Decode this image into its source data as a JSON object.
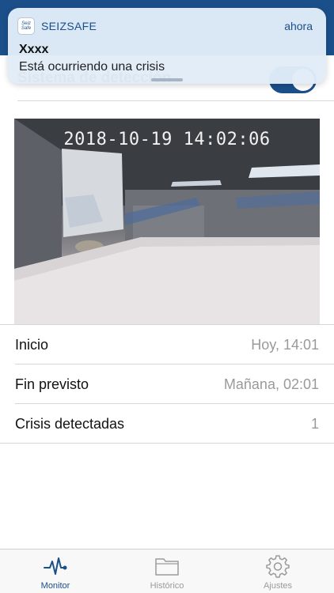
{
  "notification": {
    "app_icon_text": "Seiz Safe",
    "app_name": "SEIZSAFE",
    "time": "ahora",
    "title": "Xxxx",
    "body": "Está ocurriendo una crisis"
  },
  "detection": {
    "label": "Sistema de detección",
    "enabled": true
  },
  "camera": {
    "timestamp": "2018-10-19  14:02:06"
  },
  "info": {
    "rows": [
      {
        "label": "Inicio",
        "value": "Hoy, 14:01"
      },
      {
        "label": "Fin previsto",
        "value": "Mañana, 02:01"
      },
      {
        "label": "Crisis detectadas",
        "value": "1"
      }
    ]
  },
  "tabs": [
    {
      "label": "Monitor",
      "icon": "heartbeat-icon",
      "active": true
    },
    {
      "label": "Histórico",
      "icon": "folder-icon",
      "active": false
    },
    {
      "label": "Ajustes",
      "icon": "gear-icon",
      "active": false
    }
  ],
  "colors": {
    "accent": "#1b4f8a",
    "inactive": "#9a9a9a"
  }
}
